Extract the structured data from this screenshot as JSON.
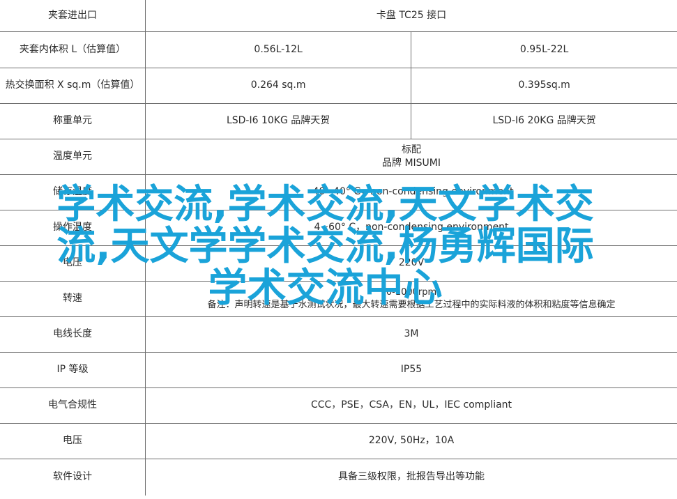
{
  "rows": [
    {
      "label": "夹套进出口",
      "span": true,
      "value": "卡盘 TC25 接口"
    },
    {
      "label": "夹套内体积 L（估算值）",
      "v1": "0.56L-12L",
      "v2": "0.95L-22L"
    },
    {
      "label": "热交换面积 X sq.m（估算值）",
      "v1": "0.264 sq.m",
      "v2": "0.395sq.m"
    },
    {
      "label": "称重单元",
      "v1": "LSD-I6 10KG 品牌天贺",
      "v2": "LSD-I6 20KG 品牌天贺"
    },
    {
      "label": "温度单元",
      "span": true,
      "line1": "标配",
      "line2": "品牌 MISUMI"
    },
    {
      "label": "储存温度",
      "span": true,
      "value": "-40~40° C，non-condensing environment"
    },
    {
      "label": "操作温度",
      "span": true,
      "value": "4~60° C，non-condensing environment"
    },
    {
      "label": "电压",
      "span": true,
      "value": "220V"
    },
    {
      "label": "转速",
      "span": true,
      "line1": "0-1000rpm",
      "line2": "备注：声明转速是基于水测试状况，最大转速需要根据工艺过程中的实际料液的体积和粘度等信息确定"
    },
    {
      "label": "电线长度",
      "span": true,
      "value": "3M"
    },
    {
      "label": "IP 等级",
      "span": true,
      "value": "IP55"
    },
    {
      "label": "电气合规性",
      "span": true,
      "value": "CCC，PSE，CSA，EN，UL，IEC compliant"
    },
    {
      "label": "电压",
      "span": true,
      "value": "220V, 50Hz，10A"
    },
    {
      "label": "软件设计",
      "span": true,
      "value": "具备三级权限，批报告导出等功能"
    }
  ],
  "watermark": {
    "line1": "学术交流,学术交流,天文学术交",
    "line2": "流,天文学学术交流,杨勇辉国际",
    "line3": "学术交流中心"
  }
}
